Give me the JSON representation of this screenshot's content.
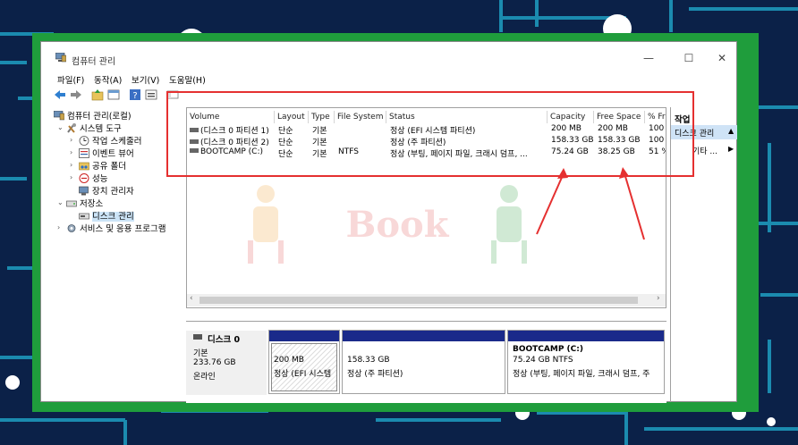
{
  "window": {
    "title": "컴퓨터 관리",
    "controls": {
      "minimize": "—",
      "maximize": "☐",
      "close": "✕"
    }
  },
  "menu": [
    "파일(F)",
    "동작(A)",
    "보기(V)",
    "도움말(H)"
  ],
  "tree": {
    "root": "컴퓨터 관리(로컬)",
    "items": [
      {
        "label": "시스템 도구",
        "level": 1
      },
      {
        "label": "작업 스케줄러",
        "level": 2
      },
      {
        "label": "이벤트 뷰어",
        "level": 2
      },
      {
        "label": "공유 폴더",
        "level": 2
      },
      {
        "label": "성능",
        "level": 2
      },
      {
        "label": "장치 관리자",
        "level": 2
      },
      {
        "label": "저장소",
        "level": 1
      },
      {
        "label": "디스크 관리",
        "level": 2
      },
      {
        "label": "서비스 및 응용 프로그램",
        "level": 1
      }
    ]
  },
  "columns": [
    "Volume",
    "Layout",
    "Type",
    "File System",
    "Status",
    "Capacity",
    "Free Space",
    "% Fr"
  ],
  "volumes": [
    {
      "volume": "(디스크 0 파티션 1)",
      "layout": "단순",
      "type": "기본",
      "fs": "",
      "status": "정상 (EFI 시스템 파티션)",
      "capacity": "200 MB",
      "free": "200 MB",
      "pct": "100"
    },
    {
      "volume": "(디스크 0 파티션 2)",
      "layout": "단순",
      "type": "기본",
      "fs": "",
      "status": "정상 (주 파티션)",
      "capacity": "158.33 GB",
      "free": "158.33 GB",
      "pct": "100"
    },
    {
      "volume": "BOOTCAMP (C:)",
      "layout": "단순",
      "type": "기본",
      "fs": "NTFS",
      "status": "정상 (부팅, 페이지 파일, 크래시 덤프, ...",
      "capacity": "75.24 GB",
      "free": "38.25 GB",
      "pct": "51 %"
    }
  ],
  "actions": {
    "header": "작업",
    "selected": "디스크 관리",
    "more": "기타 ..."
  },
  "disk": {
    "name": "디스크 0",
    "type": "기본",
    "size": "233.76 GB",
    "state": "온라인"
  },
  "partitions": [
    {
      "line1": "",
      "line2": "200 MB",
      "line3": "정상 (EFI 시스템"
    },
    {
      "line1": "",
      "line2": "158.33 GB",
      "line3": "정상 (주 파티션)"
    },
    {
      "line1": "BOOTCAMP  (C:)",
      "line2": "75.24 GB NTFS",
      "line3": "정상 (부팅, 페이지 파일, 크래시 덤프, 주"
    }
  ],
  "watermark": "Book",
  "colors": {
    "accent": "#1a2a8a",
    "annotation": "#e53030",
    "frame": "#1f9d3c",
    "selection": "#cce4f7"
  }
}
